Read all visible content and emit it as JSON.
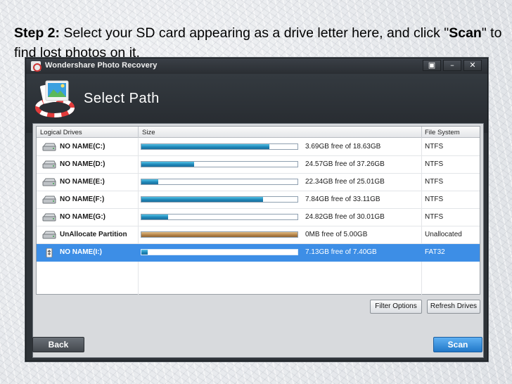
{
  "caption": {
    "step_label": "Step 2:",
    "text_1": " Select your SD card appearing as a drive letter here, and click \"",
    "scan_word": "Scan",
    "text_2": "\" to find lost photos on it."
  },
  "window": {
    "title": "Wondershare Photo Recovery",
    "header_title": "Select Path",
    "controls": {
      "restore_glyph": "▣",
      "minimize_glyph": "–",
      "close_glyph": "✕"
    }
  },
  "table": {
    "columns": [
      "Logical Drives",
      "Size",
      "File System"
    ],
    "rows": [
      {
        "name": "NO NAME(C:)",
        "size_text": "3.69GB free of 18.63GB",
        "used_fraction": 0.82,
        "fs": "NTFS",
        "type": "hdd"
      },
      {
        "name": "NO NAME(D:)",
        "size_text": "24.57GB free of 37.26GB",
        "used_fraction": 0.34,
        "fs": "NTFS",
        "type": "hdd"
      },
      {
        "name": "NO NAME(E:)",
        "size_text": "22.34GB free of 25.01GB",
        "used_fraction": 0.11,
        "fs": "NTFS",
        "type": "hdd"
      },
      {
        "name": "NO NAME(F:)",
        "size_text": "7.84GB free of 33.11GB",
        "used_fraction": 0.78,
        "fs": "NTFS",
        "type": "hdd"
      },
      {
        "name": "NO NAME(G:)",
        "size_text": "24.82GB free of 30.01GB",
        "used_fraction": 0.17,
        "fs": "NTFS",
        "type": "hdd"
      },
      {
        "name": "UnAllocate Partition",
        "size_text": "0MB free of 5.00GB",
        "used_fraction": 1.0,
        "fs": "Unallocated",
        "type": "unallocated"
      },
      {
        "name": "NO NAME(I:)",
        "size_text": "7.13GB free of 7.40GB",
        "used_fraction": 0.04,
        "fs": "FAT32",
        "type": "usb",
        "selected": true
      }
    ]
  },
  "buttons": {
    "filter": "Filter Options",
    "refresh": "Refresh Drives",
    "back": "Back",
    "scan": "Scan"
  },
  "colors": {
    "selection": "#3d8ee6",
    "bar_fill": "#2a9fd6",
    "unallocated_fill": "#b7864a",
    "scan_button": "#2f8fe0"
  }
}
